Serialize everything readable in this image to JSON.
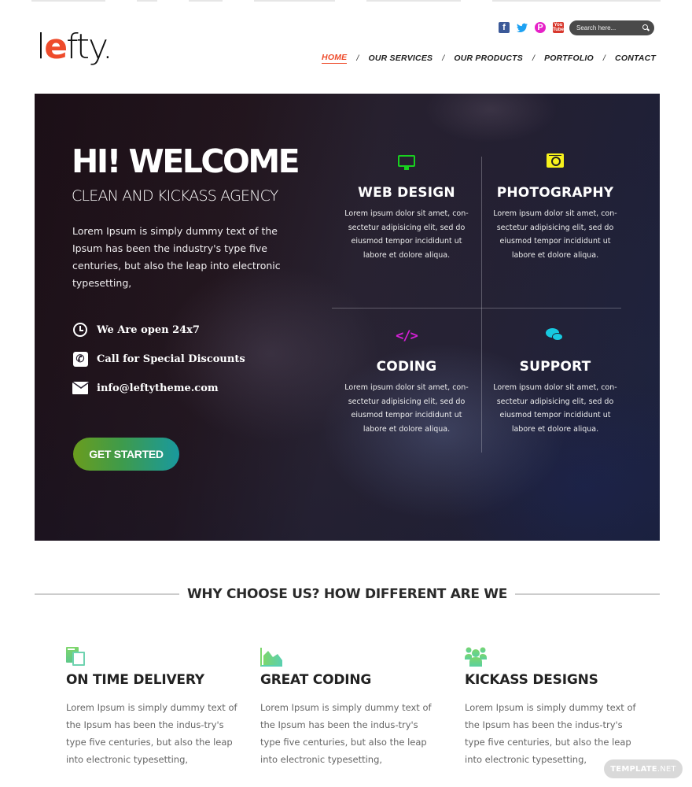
{
  "header": {
    "logo": {
      "accent": "e",
      "prefix": "l",
      "suffix": "fty."
    },
    "social": [
      {
        "name": "facebook-icon",
        "glyph": "f"
      },
      {
        "name": "twitter-icon",
        "glyph": "🐦"
      },
      {
        "name": "pinterest-icon",
        "glyph": "P"
      },
      {
        "name": "youtube-icon",
        "glyph": "You Tube"
      }
    ],
    "search": {
      "placeholder": "Search here..."
    },
    "nav": [
      {
        "label": "HOME",
        "active": true
      },
      {
        "label": "OUR SERVICES"
      },
      {
        "label": "OUR PRODUCTS"
      },
      {
        "label": "PORTFOLIO"
      },
      {
        "label": "CONTACT"
      }
    ],
    "separator": "/"
  },
  "hero": {
    "title": "HI! WELCOME",
    "subtitle": "CLEAN AND KICKASS AGENCY",
    "description": "Lorem Ipsum is simply dummy text of the Ipsum has been the industry's type five centuries, but also the leap into electronic typesetting,",
    "contacts": [
      {
        "icon": "clock-icon",
        "text": "We Are open 24x7"
      },
      {
        "icon": "phone-icon",
        "text": "Call for Special Discounts"
      },
      {
        "icon": "mail-icon",
        "text": "info@leftytheme.com"
      }
    ],
    "cta_label": "GET STARTED",
    "services": [
      {
        "icon": "monitor-icon",
        "title": "WEB DESIGN",
        "text": "Lorem ipsum dolor sit amet, con-sectetur adipisicing elit, sed do eiusmod tempor incididunt ut labore et dolore aliqua.",
        "color": "#18d11f"
      },
      {
        "icon": "camera-icon",
        "title": "PHOTOGRAPHY",
        "text": "Lorem ipsum dolor sit amet, con-sectetur adipisicing elit, sed do eiusmod tempor incididunt ut labore et dolore aliqua.",
        "color": "#f7f21c"
      },
      {
        "icon": "code-icon",
        "title": "CODING",
        "glyph": "</>",
        "text": "Lorem ipsum dolor sit amet, con-sectetur adipisicing elit, sed do eiusmod tempor incididunt ut labore et dolore aliqua.",
        "color": "#d41fd6"
      },
      {
        "icon": "chat-icon",
        "title": "SUPPORT",
        "text": "Lorem ipsum dolor sit amet, con-sectetur adipisicing elit, sed do eiusmod tempor incididunt ut labore et dolore aliqua.",
        "color": "#17c9e0"
      }
    ]
  },
  "why": {
    "heading": "WHY CHOOSE US? HOW DIFFERENT ARE WE",
    "features": [
      {
        "icon": "documents-icon",
        "title": "ON TIME DELIVERY",
        "text": "Lorem Ipsum is simply dummy text of the Ipsum has been the indus-try's type five centuries, but also the leap into electronic typesetting,"
      },
      {
        "icon": "area-chart-icon",
        "title": "GREAT CODING",
        "text": "Lorem Ipsum is simply dummy text of the Ipsum has been the indus-try's type five centuries, but also the leap into electronic typesetting,"
      },
      {
        "icon": "users-group-icon",
        "title": "KICKASS DESIGNS",
        "text": "Lorem Ipsum is simply dummy text of the Ipsum has been the indus-try's type five centuries, but also the leap into electronic typesetting,"
      }
    ]
  },
  "watermark": {
    "brand": "TEMPLATE",
    "tld": ".NET"
  },
  "colors": {
    "accent": "#ee4b2b",
    "feature_green": "#6fd38a",
    "cta_start": "#6a9c1e",
    "cta_end": "#19999e"
  }
}
